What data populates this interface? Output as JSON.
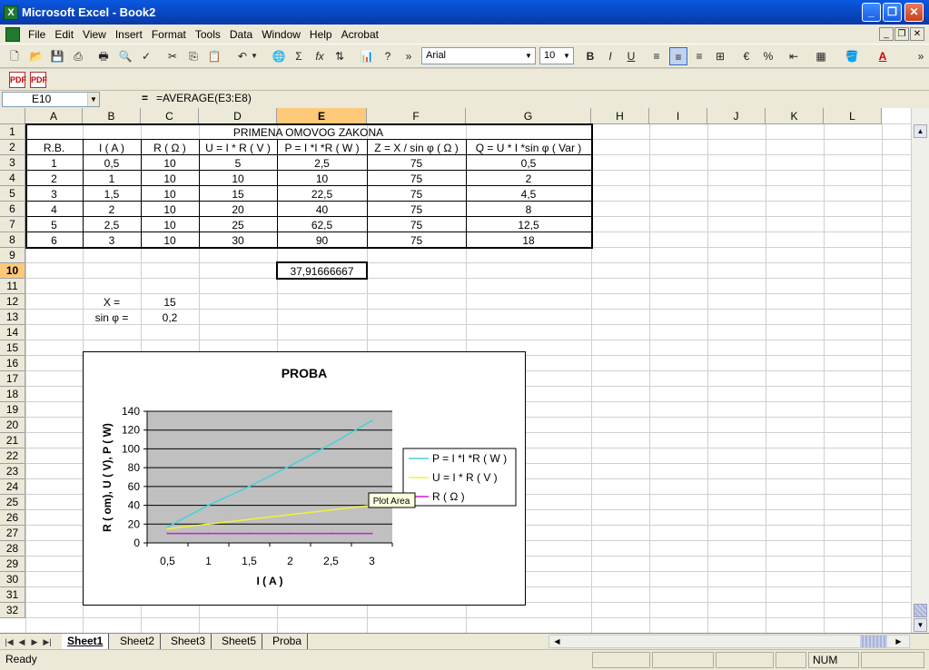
{
  "app": {
    "title": "Microsoft Excel - Book2"
  },
  "menu": [
    "File",
    "Edit",
    "View",
    "Insert",
    "Format",
    "Tools",
    "Data",
    "Window",
    "Help",
    "Acrobat"
  ],
  "toolbar": {
    "font_name": "Arial",
    "font_size": "10"
  },
  "formula_bar": {
    "name_box": "E10",
    "equals": "=",
    "formula": "=AVERAGE(E3:E8)"
  },
  "columns": [
    "A",
    "B",
    "C",
    "D",
    "E",
    "F",
    "G",
    "H",
    "I",
    "J",
    "K",
    "L"
  ],
  "active_column": "E",
  "active_row": "10",
  "rows": [
    "1",
    "2",
    "3",
    "4",
    "5",
    "6",
    "7",
    "8",
    "9",
    "10",
    "11",
    "12",
    "13",
    "14",
    "15",
    "16",
    "17",
    "18",
    "19",
    "20",
    "21",
    "22",
    "23",
    "24",
    "25",
    "26",
    "27",
    "28",
    "29",
    "30",
    "31",
    "32"
  ],
  "table": {
    "title": "PRIMENA OMOVOG ZAKONA",
    "headers": [
      "R.B.",
      "I ( A )",
      "R ( Ω )",
      "U = I * R ( V )",
      "P = I *I *R ( W )",
      "Z = X / sin φ ( Ω )",
      "Q = U * I *sin φ ( Var )"
    ],
    "data": [
      [
        "1",
        "0,5",
        "10",
        "5",
        "2,5",
        "75",
        "0,5"
      ],
      [
        "2",
        "1",
        "10",
        "10",
        "10",
        "75",
        "2"
      ],
      [
        "3",
        "1,5",
        "10",
        "15",
        "22,5",
        "75",
        "4,5"
      ],
      [
        "4",
        "2",
        "10",
        "20",
        "40",
        "75",
        "8"
      ],
      [
        "5",
        "2,5",
        "10",
        "25",
        "62,5",
        "75",
        "12,5"
      ],
      [
        "6",
        "3",
        "10",
        "30",
        "90",
        "75",
        "18"
      ]
    ]
  },
  "average_cell": "37,91666667",
  "params": [
    {
      "label": "X =",
      "value": "15"
    },
    {
      "label": "sin φ =",
      "value": "0,2"
    }
  ],
  "tooltip": "Plot Area",
  "chart_data": {
    "type": "line",
    "title": "PROBA",
    "xlabel": "I ( A )",
    "ylabel": "R ( om), U ( V), P ( W)",
    "categories": [
      "0,5",
      "1",
      "1,5",
      "2",
      "2,5",
      "3"
    ],
    "ylim": [
      0,
      140
    ],
    "yticks": [
      "0",
      "20",
      "40",
      "60",
      "80",
      "100",
      "120",
      "140"
    ],
    "legend_position": "right",
    "series": [
      {
        "name": "P = I *I *R ( W )",
        "values": [
          17,
          40,
          60,
          82,
          105,
          130
        ],
        "color": "#3fd3d8"
      },
      {
        "name": "U = I * R ( V )",
        "values": [
          15,
          20,
          25,
          30,
          35,
          40
        ],
        "color": "#f4f03a"
      },
      {
        "name": "R ( Ω )",
        "values": [
          10,
          10,
          10,
          10,
          10,
          10
        ],
        "color": "#d21cd2"
      }
    ],
    "plot_bg": "#c0c0c0"
  },
  "sheets": [
    "Sheet1",
    "Sheet2",
    "Sheet3",
    "Sheet5",
    "Proba"
  ],
  "active_sheet": "Sheet1",
  "status": {
    "text": "Ready",
    "num": "NUM"
  }
}
